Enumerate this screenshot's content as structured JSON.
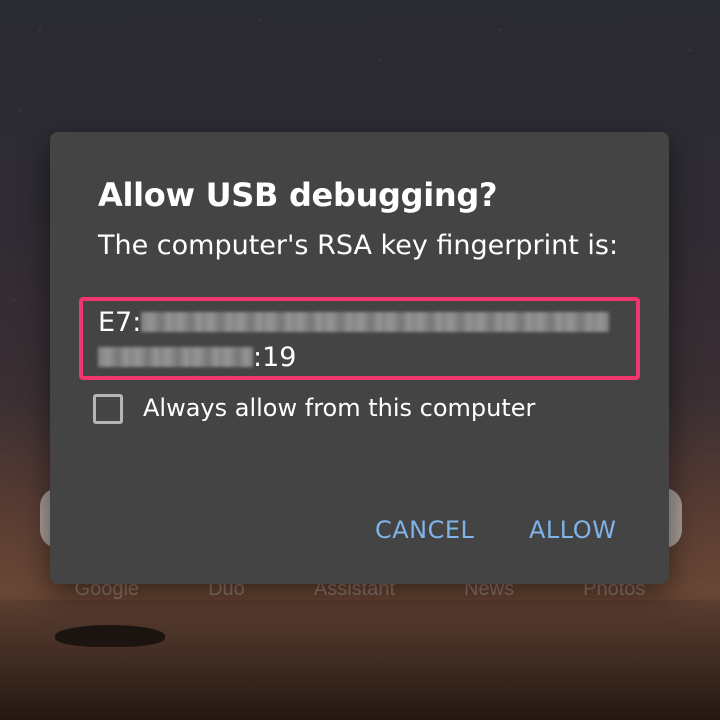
{
  "dialog": {
    "title": "Allow USB debugging?",
    "message": "The computer's RSA key fingerprint is:",
    "fingerprint_prefix": "E7:",
    "fingerprint_suffix": ":19",
    "checkbox_label": "Always allow from this computer",
    "checkbox_checked": false,
    "cancel_label": "CANCEL",
    "allow_label": "ALLOW"
  },
  "colors": {
    "dialog_bg": "#444444",
    "button_text": "#7fb3ea",
    "highlight_border": "#f0356f"
  },
  "dock": {
    "labels": [
      "Google",
      "Duo",
      "Assistant",
      "News",
      "Photos"
    ]
  }
}
